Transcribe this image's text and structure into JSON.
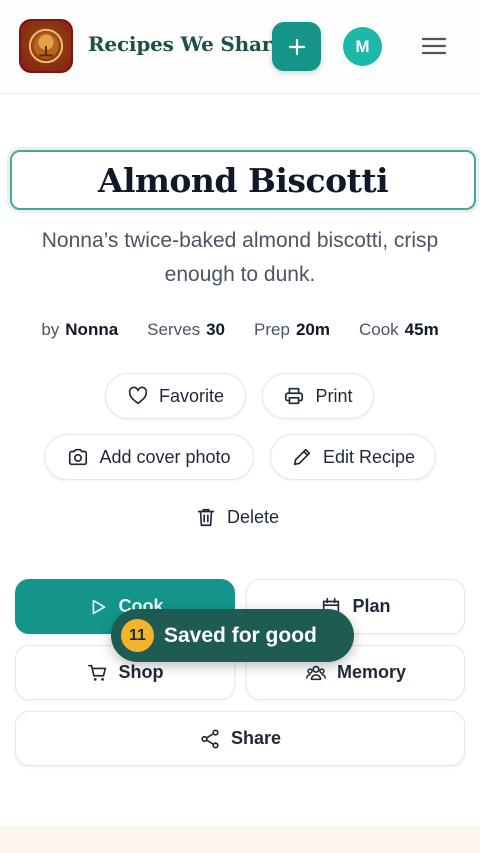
{
  "header": {
    "brand": "Recipes We Share",
    "avatar_initial": "M",
    "add_icon": "plus-icon",
    "menu_icon": "hamburger-menu-icon",
    "accent_color": "#15958a"
  },
  "recipe": {
    "title": "Almond Biscotti",
    "description": "Nonna’s twice-baked almond biscotti, crisp enough to dunk.",
    "meta": {
      "by_label": "by",
      "author": "Nonna",
      "serves_label": "Serves",
      "serves": "30",
      "prep_label": "Prep",
      "prep": "20m",
      "cook_label": "Cook",
      "cook": "45m"
    }
  },
  "buttons": {
    "favorite": "Favorite",
    "print": "Print",
    "add_cover": "Add cover photo",
    "edit": "Edit Recipe",
    "delete": "Delete"
  },
  "actions": {
    "cook": "Cook",
    "plan": "Plan",
    "shop": "Shop",
    "memory": "Memory",
    "share": "Share"
  },
  "toast": {
    "count": "11",
    "message": "Saved for good"
  }
}
